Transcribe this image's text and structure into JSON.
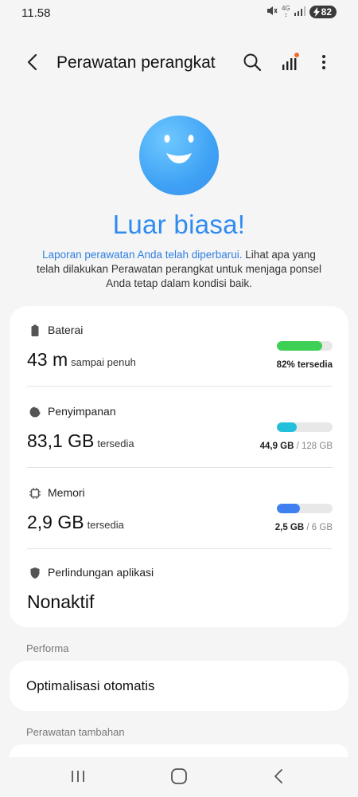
{
  "status_bar": {
    "time": "11.58",
    "network_top": "4G",
    "network_bottom": "↕",
    "battery": "82"
  },
  "header": {
    "title": "Perawatan perangkat"
  },
  "hero": {
    "headline": "Luar biasa!",
    "link_text": "Laporan perawatan Anda telah diperbarui.",
    "description": " Lihat apa yang telah dilakukan Perawatan perangkat untuk menjaga ponsel Anda tetap dalam kondisi baik."
  },
  "items": {
    "battery": {
      "label": "Baterai",
      "value": "43 m",
      "unit": "sampai penuh",
      "caption": "82% tersedia",
      "level": 0.82,
      "color": "#3ecf55"
    },
    "storage": {
      "label": "Penyimpanan",
      "value": "83,1 GB",
      "unit": "tersedia",
      "used": "44,9 GB",
      "total": "/ 128 GB",
      "level": 0.35,
      "color": "#22c0dc"
    },
    "memory": {
      "label": "Memori",
      "value": "2,9 GB",
      "unit": "tersedia",
      "used": "2,5 GB",
      "total": "/ 6 GB",
      "level": 0.42,
      "color": "#3f7ff0"
    },
    "protection": {
      "label": "Perlindungan aplikasi",
      "value": "Nonaktif"
    }
  },
  "performance": {
    "section": "Performa",
    "option": "Optimalisasi otomatis"
  },
  "extra": {
    "section": "Perawatan tambahan"
  },
  "colors": {
    "accent": "#2f8bf0",
    "background": "#f5f5f5"
  }
}
